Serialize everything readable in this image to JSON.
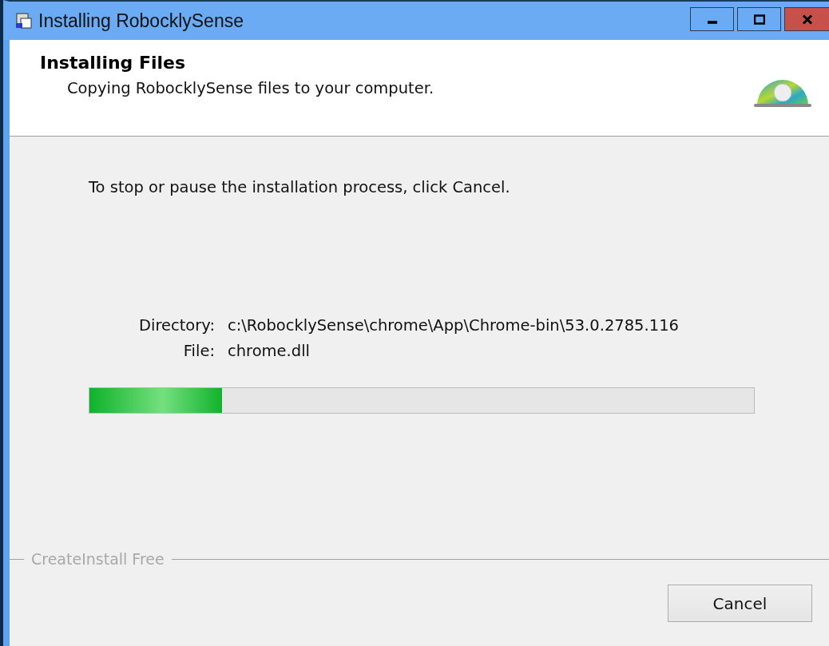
{
  "window": {
    "title": "Installing RobocklySense",
    "controls": [
      {
        "kind": "minimize"
      },
      {
        "kind": "maximize"
      },
      {
        "kind": "close"
      }
    ]
  },
  "header": {
    "title": "Installing Files",
    "subtitle": "Copying RobocklySense files to your computer."
  },
  "instruction": "To stop or pause the installation process, click Cancel.",
  "details": [
    {
      "label": "Directory:",
      "value": "c:\\RobocklySense\\chrome\\App\\Chrome-bin\\53.0.2785.116"
    },
    {
      "label": "File:",
      "value": "chrome.dll"
    }
  ],
  "progress": {
    "level": 0.2
  },
  "footer": {
    "brand": "CreateInstall Free",
    "buttons": [
      "Cancel"
    ]
  }
}
